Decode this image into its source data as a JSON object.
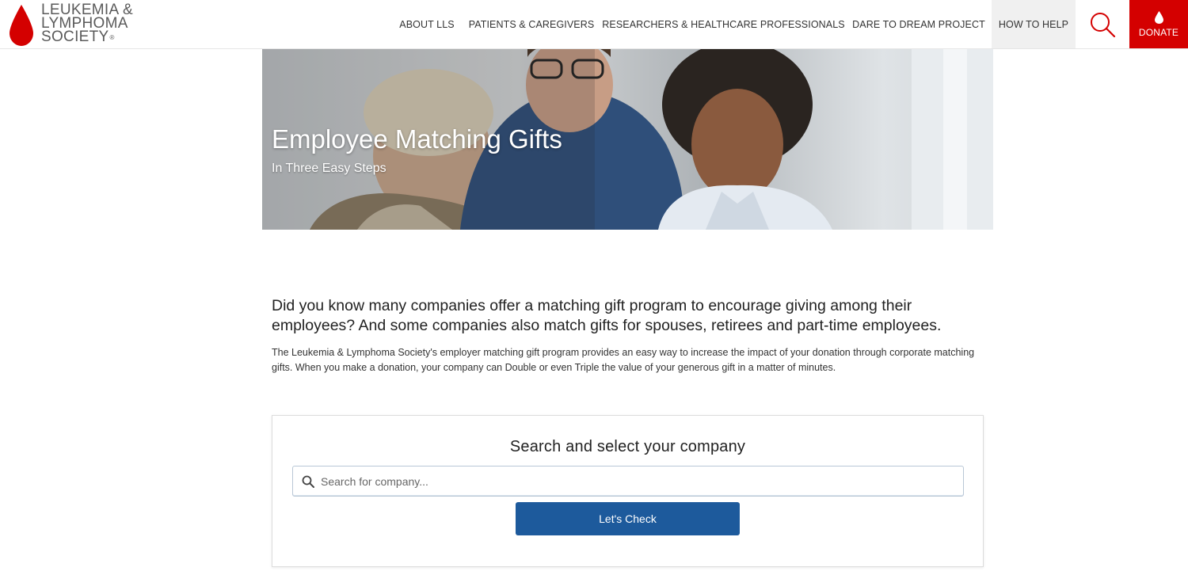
{
  "header": {
    "logo": {
      "line1": "LEUKEMIA &",
      "line2": "LYMPHOMA",
      "line3": "SOCIETY",
      "mark": "®"
    },
    "nav": [
      {
        "label": "ABOUT LLS"
      },
      {
        "label": "PATIENTS & CAREGIVERS"
      },
      {
        "label": "RESEARCHERS & HEALTHCARE PROFESSIONALS"
      },
      {
        "label": "DARE TO DREAM PROJECT"
      },
      {
        "label": "HOW TO HELP",
        "active": true
      }
    ],
    "search_icon": "search-icon",
    "donate": {
      "label": "DONATE",
      "icon": "drop-icon",
      "color": "#d40000"
    }
  },
  "hero": {
    "title": "Employee Matching Gifts",
    "subtitle": "In Three Easy Steps"
  },
  "intro": {
    "lead": "Did you know many companies offer a matching gift program to encourage giving among their employees? And some companies also match gifts for spouses, retirees and part-time employees.",
    "body": "The Leukemia & Lymphoma Society's employer matching gift program provides an easy way to increase the impact of your donation through corporate matching gifts. When you make a donation, your company can Double or even Triple the value of your generous gift in a matter of minutes."
  },
  "search_card": {
    "title": "Search and select your company",
    "placeholder": "Search for company...",
    "value": "",
    "button_label": "Let's Check",
    "button_color": "#1d5a9c"
  },
  "colors": {
    "brand_red": "#d40000",
    "nav_active_bg": "#f0f0f0"
  }
}
